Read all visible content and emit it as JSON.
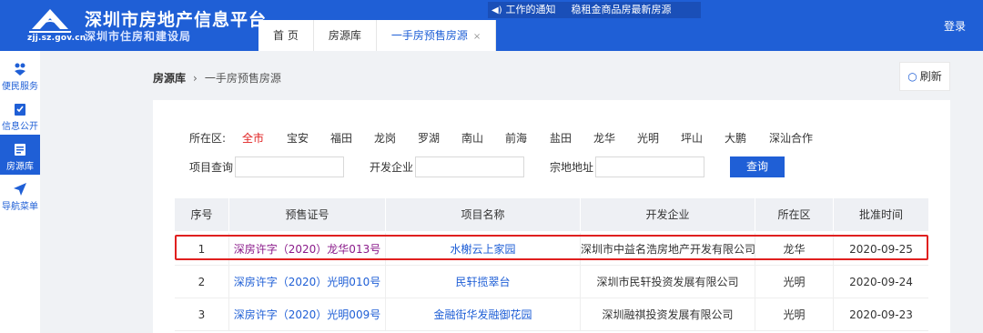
{
  "header": {
    "domain": "zjj.sz.gov.cn",
    "title": "深圳市房地产信息平台",
    "subtitle": "深圳市住房和建设局",
    "notice": {
      "item1": "工作的通知",
      "item2": "稳租金商品房最新房源"
    },
    "login_label": "登录",
    "tabs": [
      {
        "label": "首 页"
      },
      {
        "label": "房源库"
      },
      {
        "label": "一手房预售房源",
        "close": "×"
      }
    ]
  },
  "sidebar": {
    "items": [
      {
        "label": "便民服务",
        "icon": "people-service-icon"
      },
      {
        "label": "信息公开",
        "icon": "clipboard-check-icon"
      },
      {
        "label": "房源库",
        "icon": "house-library-icon"
      },
      {
        "label": "导航菜单",
        "icon": "navigation-arrow-icon"
      }
    ]
  },
  "breadcrumb": {
    "root": "房源库",
    "separator": "›",
    "current": "一手房预售房源"
  },
  "refresh_label": "刷新",
  "filters": {
    "district_label": "所在区:",
    "districts": [
      "全市",
      "宝安",
      "福田",
      "龙岗",
      "罗湖",
      "南山",
      "前海",
      "盐田",
      "龙华",
      "光明",
      "坪山",
      "大鹏",
      "深汕合作"
    ],
    "selected_district": "全市",
    "project_label": "项目查询",
    "developer_label": "开发企业",
    "parcel_label": "宗地地址",
    "project_value": "",
    "developer_value": "",
    "parcel_value": "",
    "search_label": "查询"
  },
  "table": {
    "columns": [
      "序号",
      "预售证号",
      "项目名称",
      "开发企业",
      "所在区",
      "批准时间"
    ],
    "rows": [
      {
        "no": "1",
        "permit": "深房许字（2020）龙华013号",
        "project": "水榭云上家园",
        "developer": "深圳市中益名浩房地产开发有限公司",
        "district": "龙华",
        "date": "2020-09-25"
      },
      {
        "no": "2",
        "permit": "深房许字（2020）光明010号",
        "project": "民轩揽翠台",
        "developer": "深圳市民轩投资发展有限公司",
        "district": "光明",
        "date": "2020-09-24"
      },
      {
        "no": "3",
        "permit": "深房许字（2020）光明009号",
        "project": "金融街华发融御花园",
        "developer": "深圳融祺投资发展有限公司",
        "district": "光明",
        "date": "2020-09-23"
      }
    ]
  },
  "colors": {
    "brand": "#1f5fd6",
    "selected_district": "#e02020",
    "visited_link": "#8a1a8a",
    "highlight_border": "#e0201f"
  }
}
